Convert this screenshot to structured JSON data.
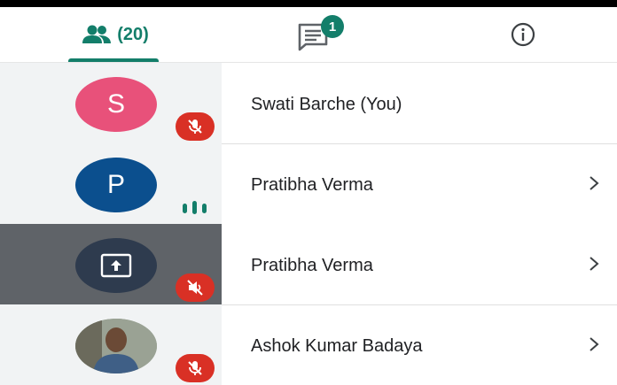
{
  "tabs": {
    "people_count": "(20)",
    "chat_unread": "1"
  },
  "participants": [
    {
      "avatar": "S",
      "avatar_color": "#e8517a",
      "name": "Swati Barche (You)",
      "status": "mic-off"
    },
    {
      "avatar": "P",
      "avatar_color": "#0b4f8e",
      "name": "Pratibha Verma",
      "status": "speaking"
    },
    {
      "avatar": "",
      "avatar_color": "#3c4a5c",
      "name": "Pratibha Verma",
      "status": "sound-off"
    },
    {
      "avatar": "",
      "avatar_color": "#7a8a7a",
      "name": "Ashok Kumar Badaya",
      "status": "mic-off"
    }
  ],
  "colors": {
    "accent": "#137e6a",
    "mute": "#d93025"
  }
}
